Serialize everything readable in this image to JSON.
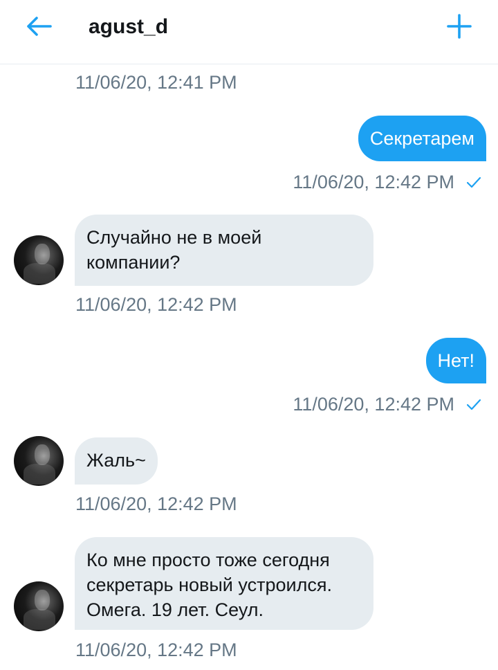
{
  "header": {
    "title": "agust_d",
    "back_icon": "arrow-left-icon",
    "add_icon": "plus-icon",
    "accent_color": "#1da1f2"
  },
  "messages": [
    {
      "type": "timestamp",
      "text": "11/06/20, 12:41 PM"
    },
    {
      "type": "outgoing",
      "text": "Секретарем",
      "timestamp": "11/06/20, 12:42 PM",
      "status_icon": "checkmark-icon"
    },
    {
      "type": "incoming",
      "lines": [
        "Случайно не в моей",
        "компании?"
      ],
      "timestamp": "11/06/20, 12:42 PM"
    },
    {
      "type": "outgoing",
      "text": "Нет!",
      "timestamp": "11/06/20, 12:42 PM",
      "status_icon": "checkmark-icon"
    },
    {
      "type": "incoming",
      "lines": [
        "Жаль~"
      ],
      "timestamp": "11/06/20, 12:42 PM"
    },
    {
      "type": "incoming",
      "lines": [
        "Ко мне просто тоже сегодня",
        "секретарь новый устроился.",
        "Омега. 19 лет. Сеул."
      ],
      "timestamp": "11/06/20, 12:42 PM"
    }
  ]
}
